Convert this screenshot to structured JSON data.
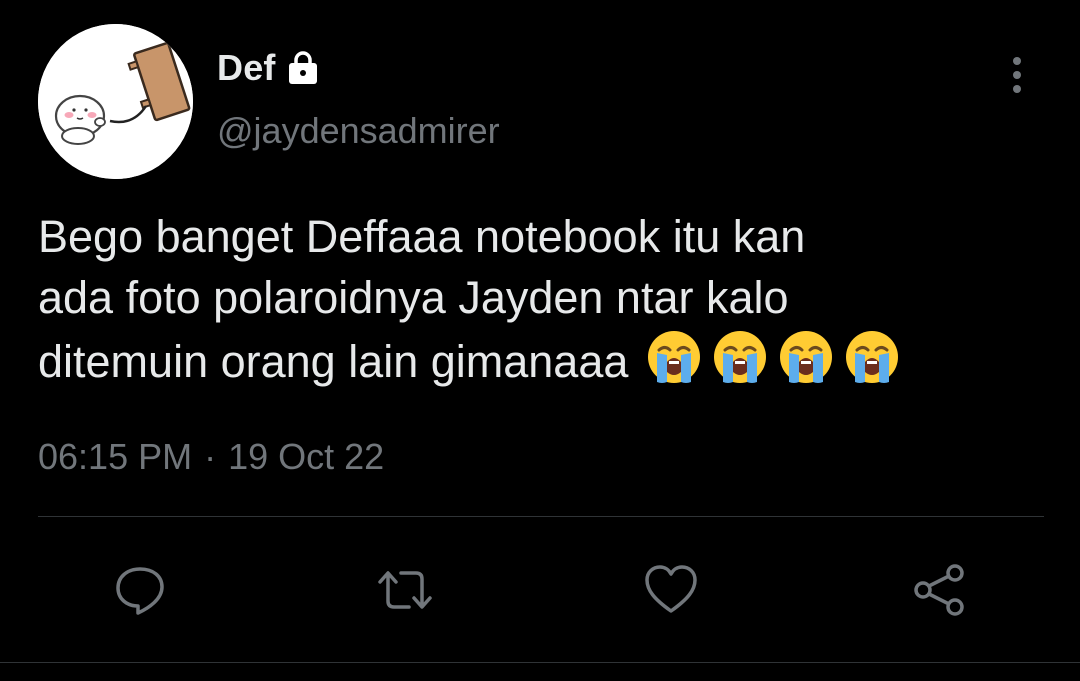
{
  "user": {
    "display_name": "Def",
    "handle": "@jaydensadmirer",
    "protected_icon": "lock-icon",
    "avatar": "avatar-cartoon-illustration"
  },
  "tweet": {
    "text": "Bego banget Deffaaa notebook itu kan\nada foto polaroidnya Jayden ntar kalo\nditemuin orang lain gimanaaa ",
    "emojis": [
      "loudly-crying-face",
      "loudly-crying-face",
      "loudly-crying-face",
      "loudly-crying-face"
    ],
    "time": "06:15 PM",
    "separator": "·",
    "date": "19 Oct 22"
  },
  "actions": {
    "reply": "reply-icon",
    "retweet": "retweet-icon",
    "like": "like-icon",
    "share": "share-icon"
  },
  "menu": {
    "more": "more-vertical-icon"
  },
  "colors": {
    "background": "#000000",
    "text_primary": "#e7e9ea",
    "text_secondary": "#71767b",
    "divider": "#2f3336",
    "icon": "#71767b"
  }
}
